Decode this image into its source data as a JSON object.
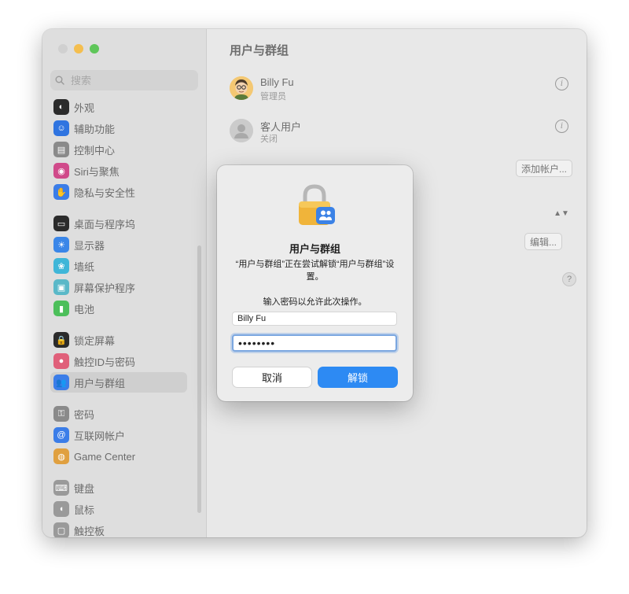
{
  "sidebar": {
    "search_placeholder": "搜索",
    "items": [
      {
        "label": "外观",
        "icon": "appearance-icon",
        "color": "#2b2b2b"
      },
      {
        "label": "辅助功能",
        "icon": "accessibility-icon",
        "color": "#2f74e0"
      },
      {
        "label": "控制中心",
        "icon": "control-center-icon",
        "color": "#8a8a8a"
      },
      {
        "label": "Siri与聚焦",
        "icon": "siri-icon",
        "color": "#d04a8a"
      },
      {
        "label": "隐私与安全性",
        "icon": "privacy-hand-icon",
        "color": "#3b7de8"
      },
      {
        "label": "桌面与程序坞",
        "icon": "desktop-dock-icon",
        "color": "#2b2b2b"
      },
      {
        "label": "显示器",
        "icon": "display-icon",
        "color": "#3a86e8"
      },
      {
        "label": "墙纸",
        "icon": "wallpaper-icon",
        "color": "#3fb6d8"
      },
      {
        "label": "屏幕保护程序",
        "icon": "screensaver-icon",
        "color": "#5ab8c8"
      },
      {
        "label": "电池",
        "icon": "battery-icon",
        "color": "#4cbf5a"
      },
      {
        "label": "锁定屏幕",
        "icon": "lock-screen-icon",
        "color": "#2b2b2b"
      },
      {
        "label": "触控ID与密码",
        "icon": "touch-id-icon",
        "color": "#e0607a"
      },
      {
        "label": "用户与群组",
        "icon": "users-groups-icon",
        "color": "#3b7de8"
      },
      {
        "label": "密码",
        "icon": "key-icon",
        "color": "#8a8a8a"
      },
      {
        "label": "互联网帐户",
        "icon": "internet-accounts-icon",
        "color": "#3b7de8"
      },
      {
        "label": "Game Center",
        "icon": "game-center-icon",
        "color": "#e0a040"
      },
      {
        "label": "键盘",
        "icon": "keyboard-icon",
        "color": "#9a9a9a"
      },
      {
        "label": "鼠标",
        "icon": "mouse-icon",
        "color": "#9a9a9a"
      },
      {
        "label": "触控板",
        "icon": "trackpad-icon",
        "color": "#9a9a9a"
      }
    ]
  },
  "main": {
    "title": "用户与群组",
    "users": [
      {
        "name": "Billy Fu",
        "role": "管理员"
      },
      {
        "name": "客人用户",
        "role": "关闭"
      }
    ],
    "add_account_label": "添加帐户...",
    "edit_label": "编辑...",
    "help_label": "?",
    "info_glyph": "i",
    "stepper_glyph_up": "▲",
    "stepper_glyph_down": "▼"
  },
  "dialog": {
    "title": "用户与群组",
    "message": "“用户与群组”正在尝试解锁“用户与群组”设置。",
    "prompt": "输入密码以允许此次操作。",
    "username_value": "Billy Fu",
    "password_value": "••••••••",
    "cancel_label": "取消",
    "unlock_label": "解锁",
    "accent_color": "#2d8af3"
  }
}
